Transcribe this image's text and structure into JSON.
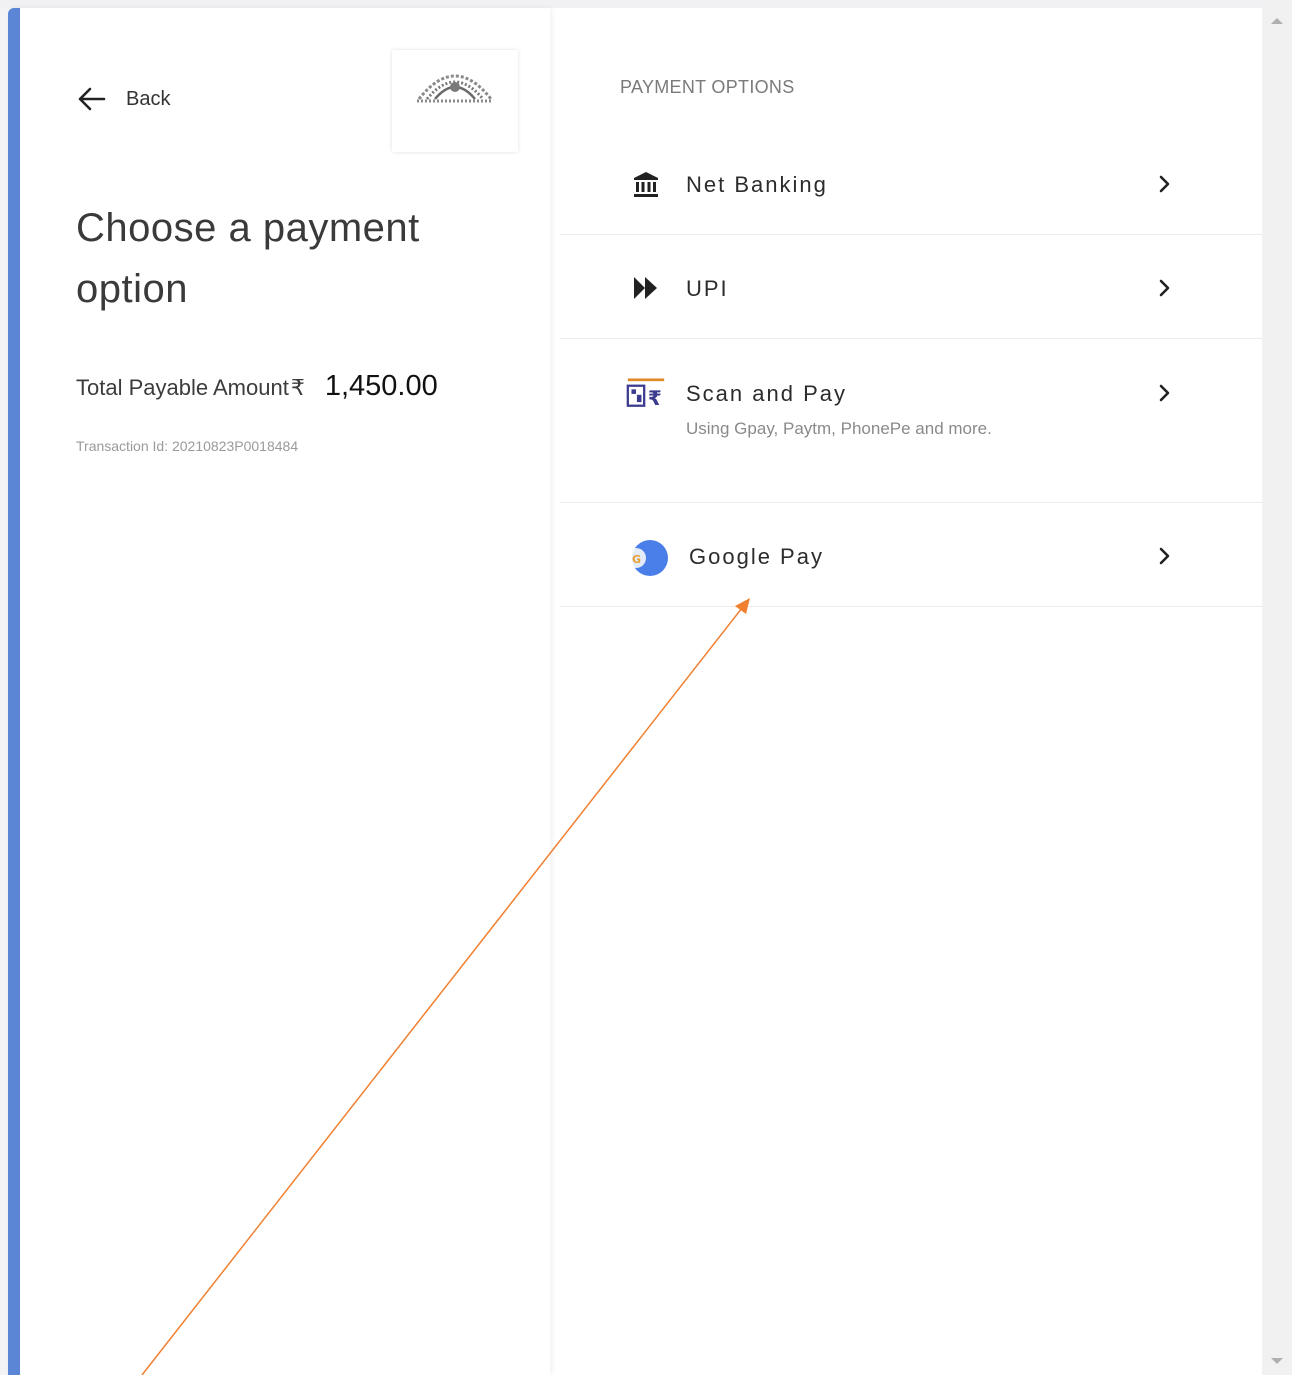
{
  "header": {
    "back_label": "Back",
    "title": "Choose a payment option"
  },
  "summary": {
    "amount_label": "Total Payable Amount",
    "currency_symbol": "₹",
    "amount": "1,450.00",
    "transaction_id": "Transaction Id: 20210823P0018484"
  },
  "payment": {
    "section_label": "PAYMENT OPTIONS",
    "options": [
      {
        "label": "Net Banking",
        "icon": "bank-icon"
      },
      {
        "label": "UPI",
        "icon": "upi-arrows-icon"
      },
      {
        "label": "Scan and Pay",
        "icon": "bharat-qr-icon",
        "subtitle": "Using Gpay, Paytm, PhonePe and more."
      },
      {
        "label": "Google Pay",
        "icon": "google-pay-icon"
      }
    ]
  },
  "colors": {
    "accent_bar": "#5b86d6",
    "annotation_arrow": "#f08030",
    "google_pay_blue": "#4a7ee8"
  }
}
